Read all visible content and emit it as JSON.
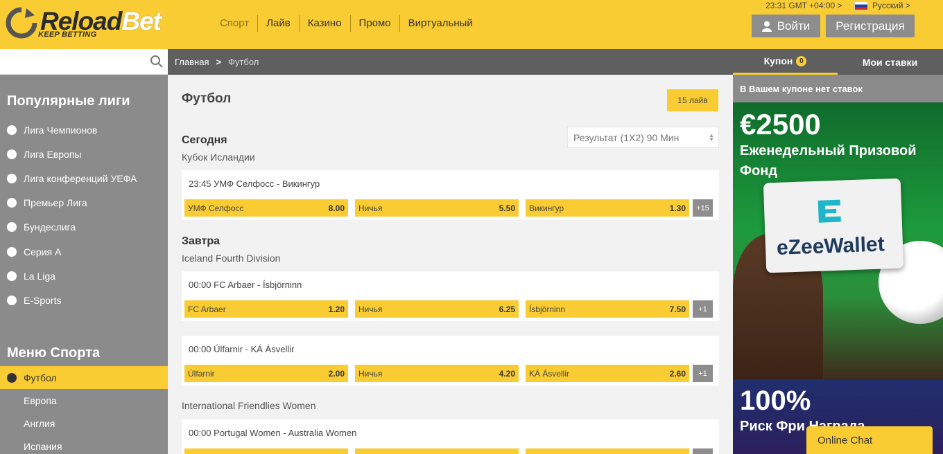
{
  "brand": {
    "name_part1": "Reload",
    "name_part2": "Bet",
    "tagline": "KEEP BETTING"
  },
  "nav": [
    "Спорт",
    "Лайв",
    "Казино",
    "Промо",
    "Виртуальный"
  ],
  "header": {
    "time": "23:31 GMT +04:00 >",
    "language": "Русский >",
    "login": "Войти",
    "register": "Регистрация"
  },
  "sidebar": {
    "search_placeholder": "",
    "popular_title": "Популярные лиги",
    "popular": [
      "Лига Чемпионов",
      "Лига Европы",
      "Лига конференций УЕФА",
      "Премьер Лига",
      "Бундеслига",
      "Серия А",
      "La Liga",
      "E-Sports"
    ],
    "menu_title": "Меню Спорта",
    "menu": [
      "Футбол",
      "Европа",
      "Англия",
      "Испания"
    ]
  },
  "breadcrumb": {
    "home": "Главная",
    "sep": ">",
    "current": "Футбол"
  },
  "main": {
    "title": "Футбол",
    "live_button": "15 лайв",
    "market": "Результат (1X2) 90 Мин",
    "today": "Сегодня",
    "tomorrow": "Завтра",
    "league1": "Кубок Исландии",
    "league2": "Iceland Fourth Division",
    "league3": "International Friendlies Women",
    "matches": [
      {
        "title": "23:45 УМФ Селфосс - Викингур",
        "home": "УМФ Селфосс",
        "home_odd": "8.00",
        "draw": "Ничья",
        "draw_odd": "5.50",
        "away": "Викингур",
        "away_odd": "1.30",
        "more": "+15"
      },
      {
        "title": "00:00 FC Arbaer - Ísbjörninn",
        "home": "FC Arbaer",
        "home_odd": "1.20",
        "draw": "Ничья",
        "draw_odd": "6.25",
        "away": "Ísbjörninn",
        "away_odd": "7.50",
        "more": "+1"
      },
      {
        "title": "00:00 Úlfarnir - KÁ Ásvellir",
        "home": "Úlfarnir",
        "home_odd": "2.00",
        "draw": "Ничья",
        "draw_odd": "4.20",
        "away": "KÁ Ásvellir",
        "away_odd": "2.60",
        "more": "+1"
      },
      {
        "title": "00:00 Portugal Women - Australia Women"
      }
    ]
  },
  "coupon": {
    "tab_coupon": "Купон",
    "count": "0",
    "tab_bets": "Мои ставки",
    "empty": "В Вашем купоне нет ставок"
  },
  "promo1": {
    "amount": "€2500",
    "text": "Еженедельный Призовой Фонд",
    "wallet": "eZeeWallet"
  },
  "promo2": {
    "pct": "100%",
    "text": "Риск Фри Награда"
  },
  "chat": "Online Chat",
  "colors": {
    "accent": "#f9cc34",
    "sidebar": "#8b8b8b",
    "dark_bar": "#5f5f5f"
  }
}
